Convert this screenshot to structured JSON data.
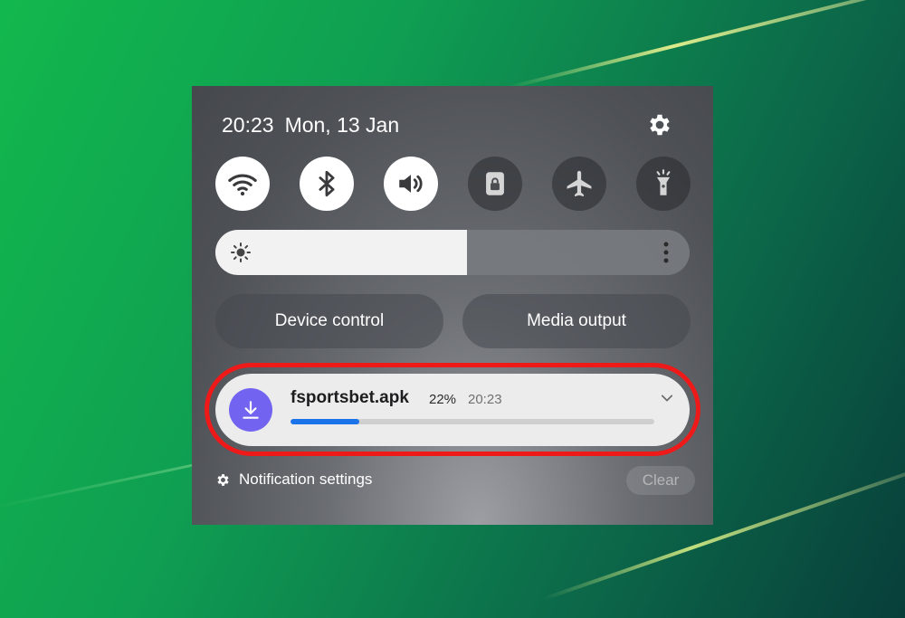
{
  "status": {
    "time": "20:23",
    "date": "Mon, 13 Jan"
  },
  "settings_icon": "gear-icon",
  "quick_toggles": [
    {
      "icon": "wifi-icon",
      "state": "on"
    },
    {
      "icon": "bluetooth-icon",
      "state": "on"
    },
    {
      "icon": "sound-icon",
      "state": "on"
    },
    {
      "icon": "lock-icon",
      "state": "off"
    },
    {
      "icon": "airplane-icon",
      "state": "off"
    },
    {
      "icon": "flashlight-icon",
      "state": "off"
    }
  ],
  "brightness": {
    "level": 0.53,
    "icon": "sun-icon"
  },
  "buttons": {
    "device_control": "Device control",
    "media_output": "Media output"
  },
  "notification": {
    "icon": "download-icon",
    "filename": "fsportsbet.apk",
    "percent": "22%",
    "progress": 0.19,
    "time": "20:23"
  },
  "footer": {
    "settings_label": "Notification settings",
    "clear_label": "Clear"
  },
  "colors": {
    "highlight": "#ee1a1a",
    "download_icon_bg": "#7264f0",
    "progress": "#1a73e8"
  }
}
